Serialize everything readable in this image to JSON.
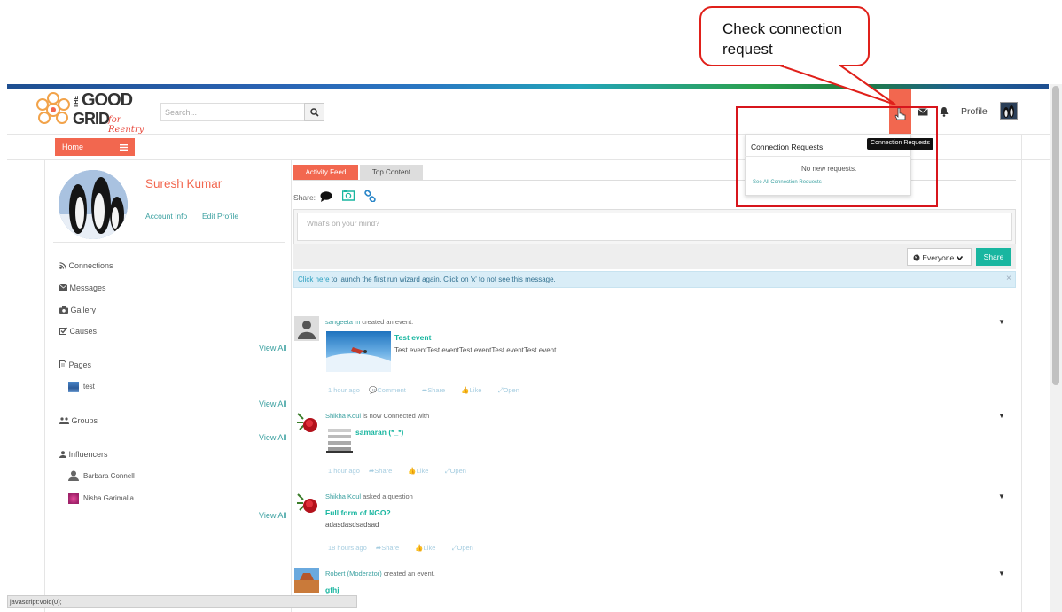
{
  "callout": {
    "text_line1": "Check connection",
    "text_line2": "request"
  },
  "header": {
    "logo": {
      "word1": "THE",
      "word2": "GOOD",
      "word3": "GRID",
      "tagline": "for Reentry"
    },
    "search_placeholder": "Search...",
    "profile_label": "Profile"
  },
  "nav": {
    "home_label": "Home"
  },
  "profile": {
    "name": "Suresh Kumar",
    "account_info": "Account Info",
    "edit_profile": "Edit Profile"
  },
  "sidebar": {
    "items": [
      {
        "label": "Connections",
        "icon": "rss-icon"
      },
      {
        "label": "Messages",
        "icon": "envelope-icon"
      },
      {
        "label": "Gallery",
        "icon": "camera-icon"
      },
      {
        "label": "Causes",
        "icon": "checkbox-icon"
      }
    ],
    "view_all": "View All",
    "pages_label": "Pages",
    "pages": [
      {
        "label": "test"
      }
    ],
    "groups_label": "Groups",
    "influencers_label": "Influencers",
    "influencers": [
      {
        "name": "Barbara Connell"
      },
      {
        "name": "Nisha Garimalla"
      }
    ]
  },
  "tabs": {
    "activity_feed": "Activity Feed",
    "top_content": "Top Content"
  },
  "composer": {
    "share_label": "Share:",
    "placeholder": "What's on your mind?",
    "audience": "Everyone",
    "share_button": "Share"
  },
  "notice": {
    "link": "Click here",
    "text": " to launch the first run wizard again. Click on 'x' to not see this message."
  },
  "feed": [
    {
      "who": "sangeeta m",
      "action": " created an event.",
      "title": "Test event",
      "desc": "Test eventTest eventTest eventTest eventTest event",
      "time": "1 hour ago",
      "comment": "Comment",
      "share": "Share",
      "like": "Like",
      "open": "Open"
    },
    {
      "who": "Shikha Koul",
      "action": " is now Connected with",
      "title": "samaran (*_*)",
      "time": "1 hour ago",
      "share": "Share",
      "like": "Like",
      "open": "Open"
    },
    {
      "who": "Shikha Koul",
      "action": " asked a question",
      "title": "Full form of NGO?",
      "desc": "adasdasdsadsad",
      "time": "18 hours ago",
      "share": "Share",
      "like": "Like",
      "open": "Open"
    },
    {
      "who": "Robert (Moderator)",
      "action": " created an event.",
      "title": "gfhj"
    }
  ],
  "connection_dropdown": {
    "title": "Connection Requests",
    "empty": "No new requests.",
    "see_all": "See All Connection Requests",
    "tooltip": "Connection Requests"
  },
  "status_bar": "javascript:void(0);",
  "colors": {
    "accent": "#f2674f",
    "teal": "#19b6a0",
    "link": "#3aa0a0",
    "highlight_red": "#d7151c"
  }
}
